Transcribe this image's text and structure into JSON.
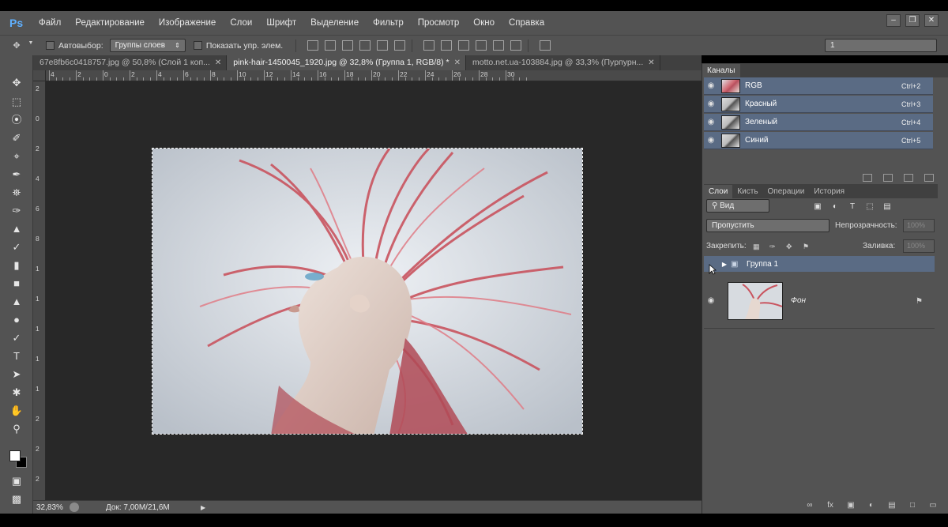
{
  "app": {
    "logo": "Ps",
    "menu": [
      "Файл",
      "Редактирование",
      "Изображение",
      "Слои",
      "Шрифт",
      "Выделение",
      "Фильтр",
      "Просмотр",
      "Окно",
      "Справка"
    ]
  },
  "options_bar": {
    "autoselect_label": "Автовыбор:",
    "autoselect_value": "Группы слоев",
    "show_transform_label": "Показать упр. элем.",
    "workspace_value": "1"
  },
  "document_tabs": [
    {
      "label": "67e8fb6c0418757.jpg @ 50,8% (Слой 1 коп...",
      "active": false
    },
    {
      "label": "pink-hair-1450045_1920.jpg @ 32,8% (Группа 1, RGB/8) *",
      "active": true
    },
    {
      "label": "motto.net.ua-103884.jpg @ 33,3% (Пурпурн...",
      "active": false
    }
  ],
  "rulers": {
    "h_labels": [
      "4",
      "2",
      "0",
      "2",
      "4",
      "6",
      "8",
      "10",
      "12",
      "14",
      "16",
      "18",
      "20",
      "22",
      "24",
      "26",
      "28",
      "30"
    ],
    "v_labels": [
      "2",
      "0",
      "2",
      "4",
      "6",
      "8",
      "1",
      "1",
      "1",
      "1",
      "1",
      "2",
      "2",
      "2"
    ]
  },
  "status_bar": {
    "zoom": "32,83%",
    "doc_info": "Док: 7,00M/21,6M"
  },
  "channels_panel": {
    "title": "Каналы",
    "channels": [
      {
        "name": "RGB",
        "shortcut": "Ctrl+2"
      },
      {
        "name": "Красный",
        "shortcut": "Ctrl+3"
      },
      {
        "name": "Зеленый",
        "shortcut": "Ctrl+4"
      },
      {
        "name": "Синий",
        "shortcut": "Ctrl+5"
      }
    ]
  },
  "layers_panel": {
    "tabs": [
      "Слои",
      "Кисть",
      "Операции",
      "История"
    ],
    "filter_value": "Вид",
    "blend_mode": "Пропустить",
    "opacity_label": "Непрозрачность:",
    "opacity_value": "100%",
    "lock_label": "Закрепить:",
    "fill_label": "Заливка:",
    "fill_value": "100%",
    "layers": [
      {
        "name": "Группа 1",
        "type": "group",
        "selected": true
      },
      {
        "name": "Фон",
        "type": "background",
        "locked": true
      }
    ]
  },
  "colors": {
    "selection_blue": "#5a6b84",
    "panel_gray": "#535353",
    "canvas_bg": "#282828"
  }
}
